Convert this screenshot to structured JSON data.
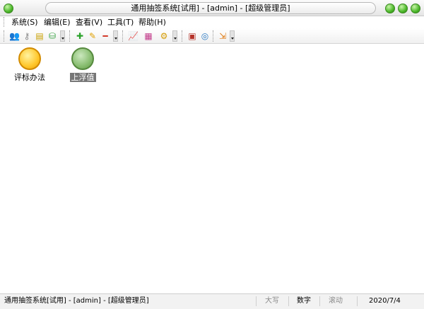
{
  "window": {
    "title": "通用抽签系统[试用] - [admin] - [超级管理员]",
    "orb_color": "#4cb82a"
  },
  "menu": {
    "items": [
      "系统(S)",
      "编辑(E)",
      "查看(V)",
      "工具(T)",
      "帮助(H)"
    ]
  },
  "toolbar": {
    "icons": [
      "users-icon",
      "key-icon",
      "document-icon",
      "database-icon",
      "add-icon",
      "edit-pencil-icon",
      "remove-icon",
      "chart-line-icon",
      "report-icon",
      "settings-gear-icon",
      "calculator-icon",
      "globe-search-icon",
      "exit-icon"
    ]
  },
  "canvas": {
    "nodes": [
      {
        "label": "评标办法",
        "color": "#ffc72b"
      },
      {
        "label": "上浮值",
        "color": "#88bd70"
      }
    ]
  },
  "status": {
    "app_text": "通用抽签系统[试用] - [admin] - [超级管理员]",
    "caps": "大写",
    "num": "数字",
    "scroll": "滚动",
    "date": "2020/7/4"
  }
}
